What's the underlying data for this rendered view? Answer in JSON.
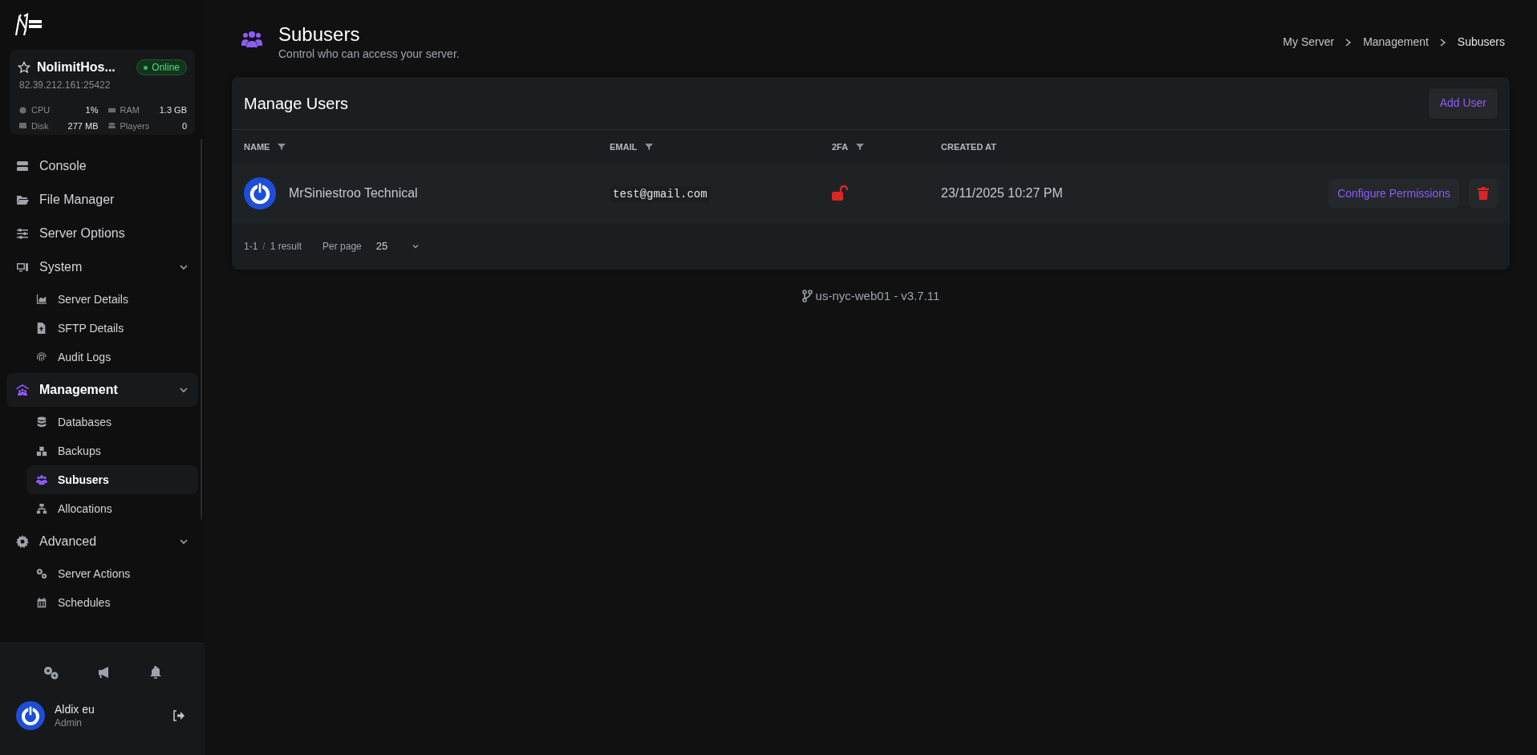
{
  "sidebar": {
    "server": {
      "name": "NolimitHos...",
      "address": "82.39.212.161:25422",
      "status": "Online",
      "online": true,
      "favorite": false,
      "stats": [
        {
          "kind": "cpu",
          "label": "CPU",
          "value": "1%"
        },
        {
          "kind": "ram",
          "label": "RAM",
          "value": "1.3 GB"
        },
        {
          "kind": "disk",
          "label": "Disk",
          "value": "277 MB"
        },
        {
          "kind": "players",
          "label": "Players",
          "value": "0"
        }
      ]
    },
    "nav": [
      {
        "kind": "console",
        "label": "Console",
        "selected": false
      },
      {
        "kind": "files",
        "label": "File Manager",
        "selected": false
      },
      {
        "kind": "options",
        "label": "Server Options",
        "selected": false
      },
      {
        "kind": "system",
        "label": "System",
        "selected": false,
        "expanded": true,
        "children": [
          {
            "kind": "details",
            "label": "Server Details",
            "selected": false
          },
          {
            "kind": "sftp",
            "label": "SFTP Details",
            "selected": false
          },
          {
            "kind": "audit",
            "label": "Audit Logs",
            "selected": false
          }
        ]
      },
      {
        "kind": "management",
        "label": "Management",
        "selected": true,
        "expanded": true,
        "children": [
          {
            "kind": "databases",
            "label": "Databases",
            "selected": false
          },
          {
            "kind": "backups",
            "label": "Backups",
            "selected": false
          },
          {
            "kind": "subusers",
            "label": "Subusers",
            "selected": true
          },
          {
            "kind": "allocations",
            "label": "Allocations",
            "selected": false
          }
        ]
      },
      {
        "kind": "advanced",
        "label": "Advanced",
        "selected": false,
        "expanded": true,
        "children": [
          {
            "kind": "actions",
            "label": "Server Actions",
            "selected": false
          },
          {
            "kind": "schedules",
            "label": "Schedules",
            "selected": false
          }
        ]
      }
    ],
    "user": {
      "name": "Aldix eu",
      "role": "Admin"
    }
  },
  "header": {
    "title": "Subusers",
    "subtitle": "Control who can access your server.",
    "breadcrumb": [
      "My Server",
      "Management",
      "Subusers"
    ]
  },
  "card": {
    "title": "Manage Users",
    "add_button": "Add User",
    "columns": [
      {
        "label": "NAME",
        "filter": true
      },
      {
        "label": "EMAIL",
        "filter": true
      },
      {
        "label": "2FA",
        "filter": true
      },
      {
        "label": "CREATED AT",
        "filter": false
      }
    ],
    "rows": [
      {
        "name": "MrSiniestroo Technical",
        "email": "test@gmail.com",
        "two_factor": false,
        "created": "23/11/2025 10:27 PM",
        "action": "Configure Permissions"
      }
    ],
    "pagination": {
      "range": "1-1",
      "separator": "/",
      "result": "1 result",
      "per_page_label": "Per page",
      "per_page": "25"
    }
  },
  "footer": "us-nyc-web01 - v3.7.11"
}
